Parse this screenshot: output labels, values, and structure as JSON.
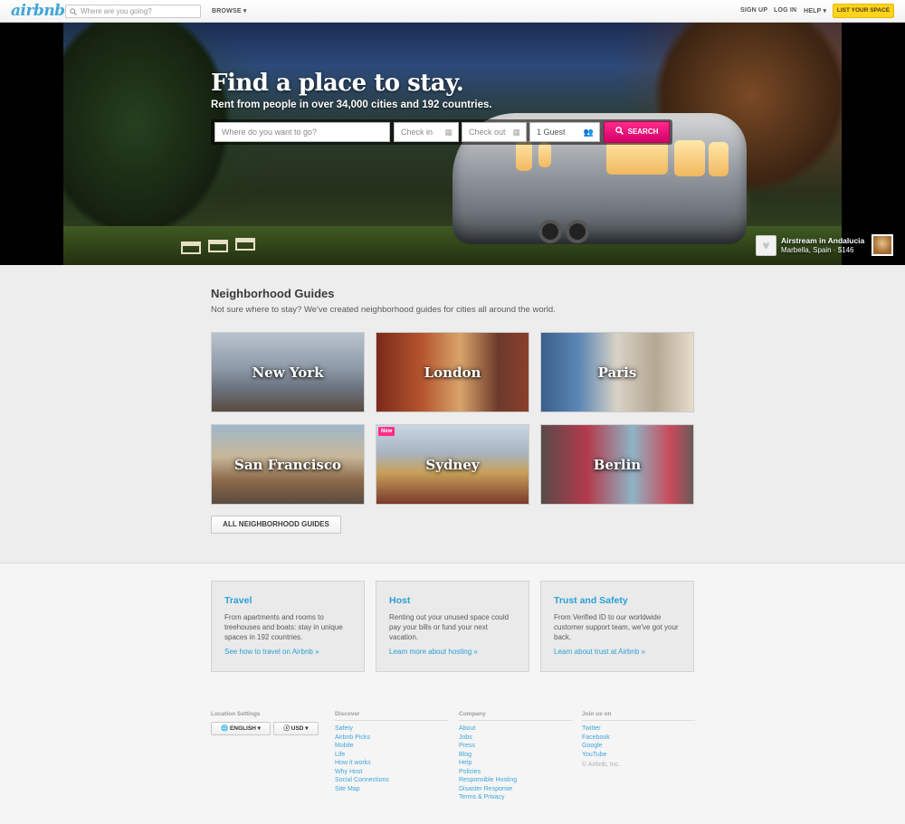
{
  "header": {
    "logo": "airbnb",
    "search_placeholder": "Where are you going?",
    "browse": "BROWSE ▾",
    "sign_up": "SIGN UP",
    "log_in": "LOG IN",
    "help": "HELP ▾",
    "list_space": "LIST YOUR SPACE"
  },
  "hero": {
    "title": "Find a place to stay.",
    "subtitle": "Rent from people in over 34,000 cities and 192 countries.",
    "where_placeholder": "Where do you want to go?",
    "check_in_placeholder": "Check in",
    "check_out_placeholder": "Check out",
    "guests": "1 Guest",
    "search_label": "SEARCH",
    "caption_title": "Airstream in Andalucia",
    "caption_sub": "Marbella, Spain · $146"
  },
  "guides": {
    "title": "Neighborhood Guides",
    "subtitle": "Not sure where to stay? We've created neighborhood guides for cities all around the world.",
    "cities": [
      "New York",
      "London",
      "Paris",
      "San Francisco",
      "Sydney",
      "Berlin"
    ],
    "new_badge": "New",
    "all_button": "ALL NEIGHBORHOOD GUIDES"
  },
  "cards": [
    {
      "title": "Travel",
      "body": "From apartments and rooms to treehouses and boats: stay in unique spaces in 192 countries.",
      "link": "See how to travel on Airbnb »"
    },
    {
      "title": "Host",
      "body": "Renting out your unused space could pay your bills or fund your next vacation.",
      "link": "Learn more about hosting »"
    },
    {
      "title": "Trust and Safety",
      "body": "From Verified ID to our worldwide customer support team, we've got your back.",
      "link": "Learn about trust at Airbnb »"
    }
  ],
  "footer": {
    "location_settings": "Location Settings",
    "language": "ENGLISH ▾",
    "currency": "USD ▾",
    "discover": {
      "heading": "Discover",
      "links": [
        "Safety",
        "Airbnb Picks",
        "Mobile",
        "Life",
        "How it works",
        "Why Host",
        "Social Connections",
        "Site Map"
      ]
    },
    "company": {
      "heading": "Company",
      "links": [
        "About",
        "Jobs",
        "Press",
        "Blog",
        "Help",
        "Policies",
        "Responsible Hosting",
        "Disaster Response",
        "Terms & Privacy"
      ]
    },
    "join": {
      "heading": "Join us on",
      "links": [
        "Twitter",
        "Facebook",
        "Google",
        "YouTube"
      ]
    },
    "copyright": "© Airbnb, Inc."
  },
  "colors": {
    "brand_blue": "#3fa5d7",
    "search_pink": "#e6007a",
    "list_yellow": "#ffd31e",
    "link_blue": "#2a9fd6"
  }
}
